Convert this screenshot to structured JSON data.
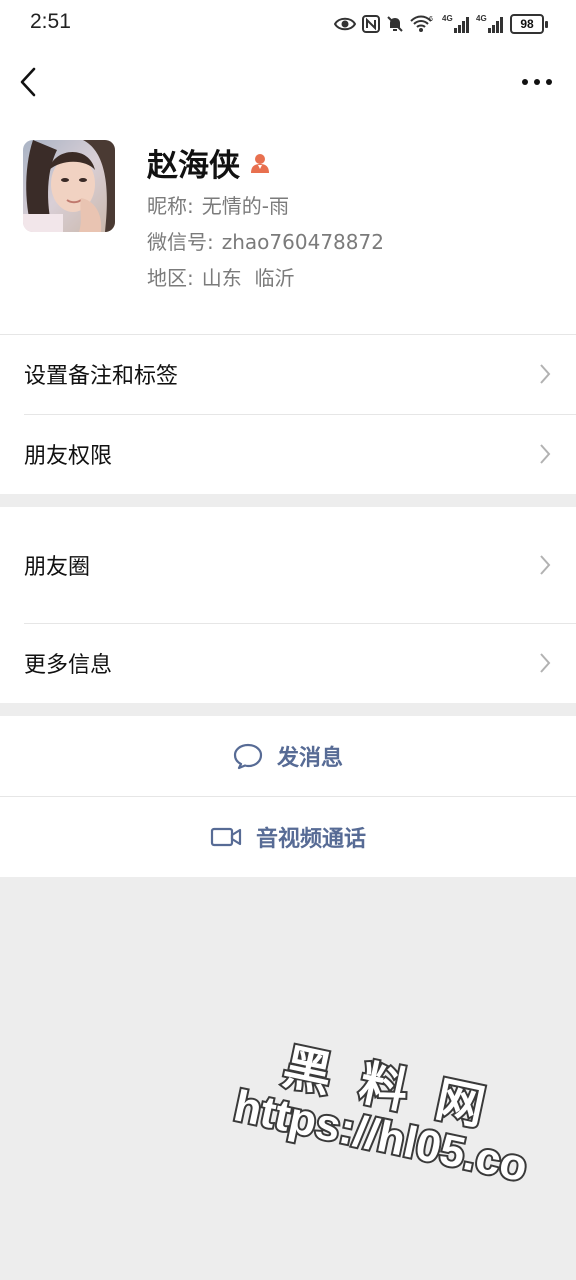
{
  "status_bar": {
    "time": "2:51",
    "battery": "98",
    "icons": [
      "eye-icon",
      "nfc-icon",
      "mute-bell-icon",
      "wifi-icon",
      "signal-4g-icon",
      "signal-4g-icon"
    ],
    "network_label": "4G"
  },
  "nav": {
    "back_icon": "chevron-left-icon",
    "more_icon": "more-dots-icon"
  },
  "profile": {
    "name": "赵海侠",
    "nickname_label": "昵称:",
    "nickname": "无情的-雨",
    "wechat_id_label": "微信号:",
    "wechat_id": "zhao760478872",
    "region_label": "地区:",
    "region": "山东  临沂",
    "badge_color": "#e8704f"
  },
  "menu": {
    "group1": [
      "设置备注和标签",
      "朋友权限"
    ],
    "group2": [
      "朋友圈",
      "更多信息"
    ]
  },
  "actions": {
    "message": "发消息",
    "call": "音视频通话",
    "accent": "#576b95"
  },
  "watermark": {
    "title": "黑料网",
    "url": "https://hl05.co"
  }
}
